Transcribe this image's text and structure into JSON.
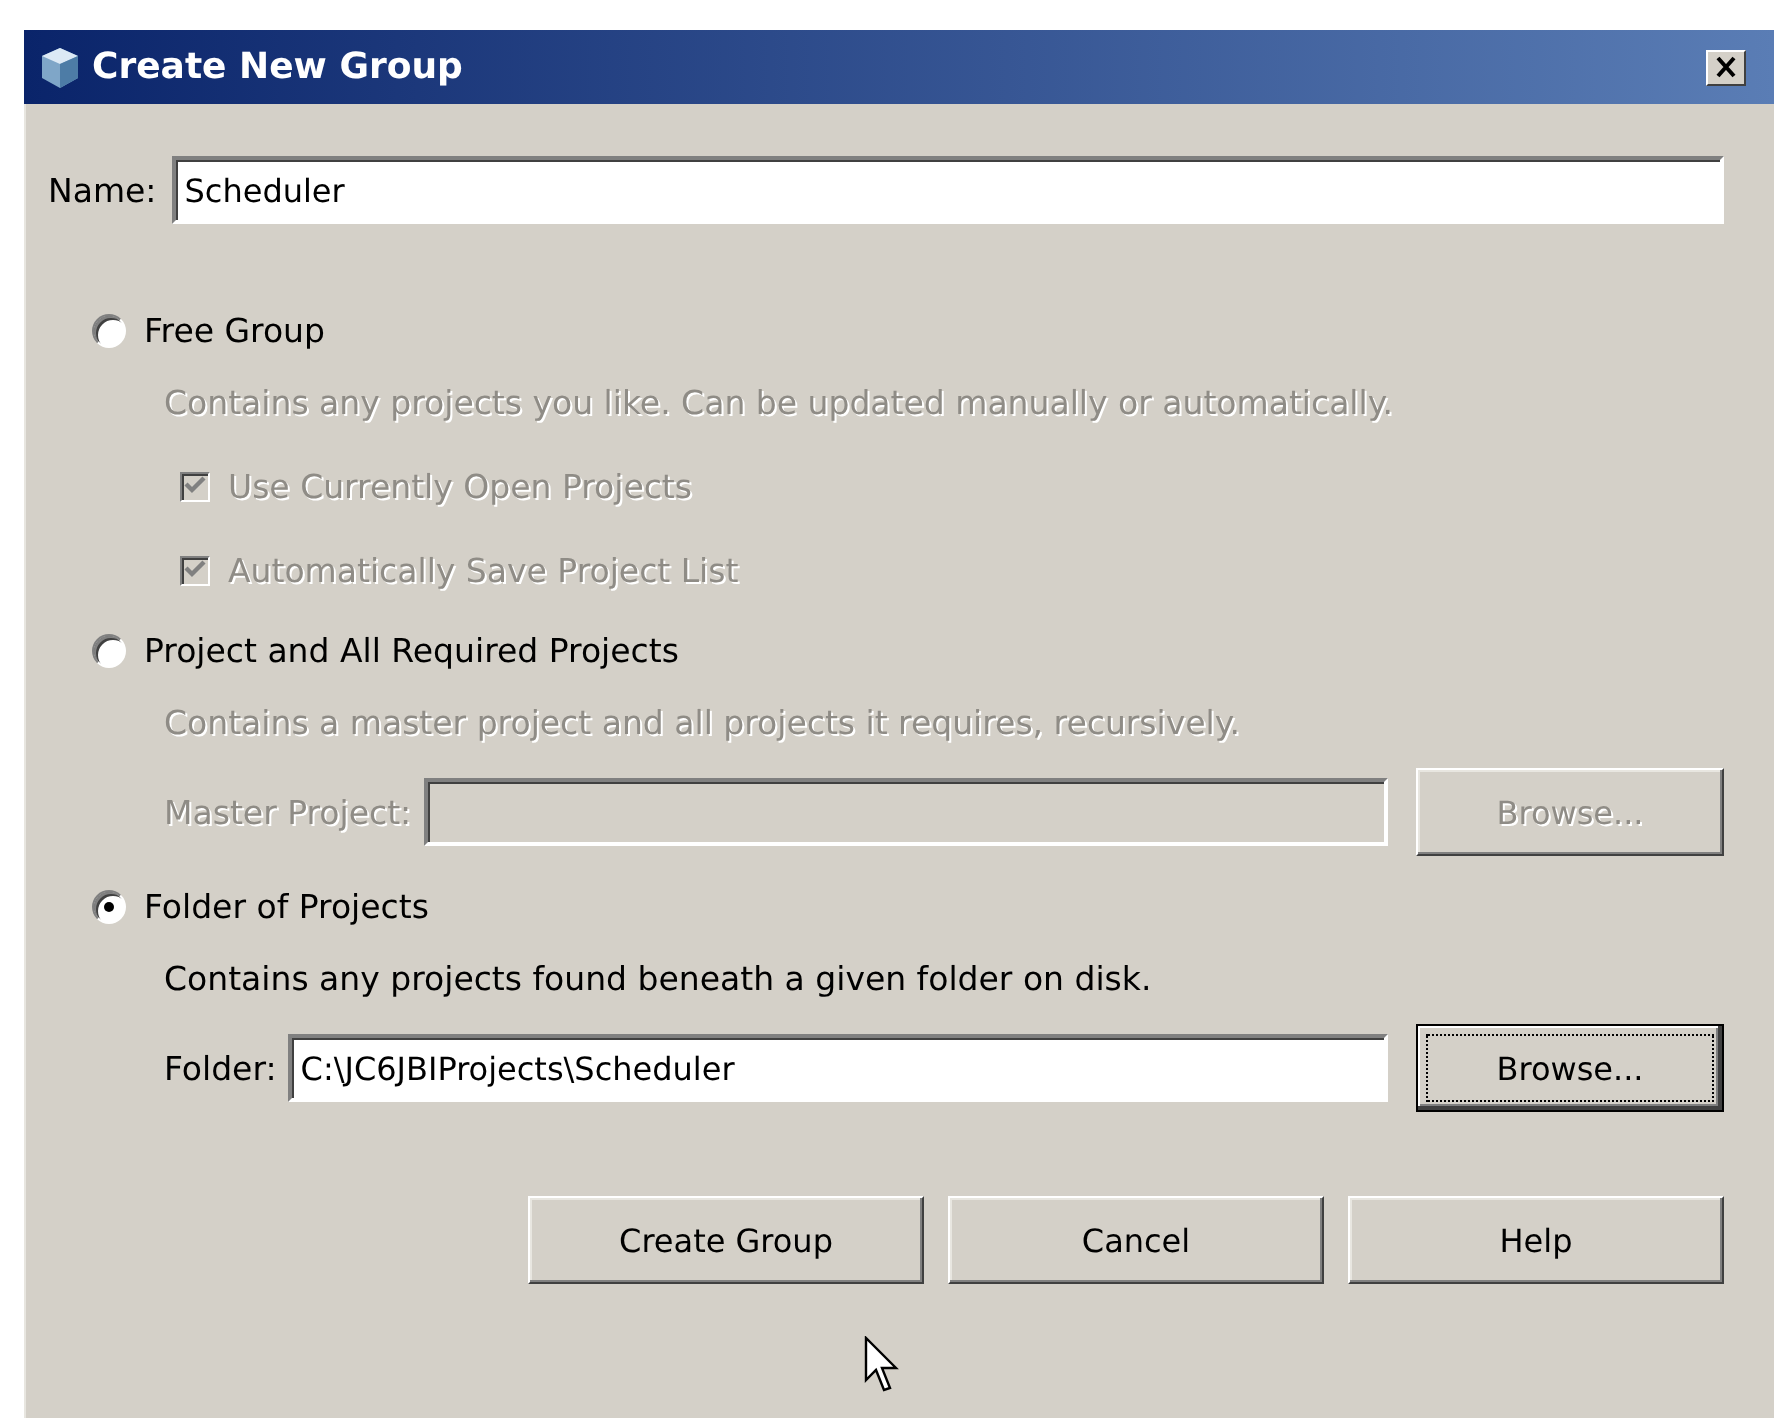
{
  "window": {
    "title": "Create New Group"
  },
  "name_field": {
    "label": "Name:",
    "value": "Scheduler"
  },
  "options": [
    {
      "label": "Free Group",
      "selected": false,
      "description": "Contains any projects you like. Can be updated manually or automatically.",
      "checkboxes": [
        {
          "label": "Use Currently Open Projects",
          "checked": true,
          "disabled": true
        },
        {
          "label": "Automatically Save Project List",
          "checked": true,
          "disabled": true
        }
      ]
    },
    {
      "label": "Project and All Required Projects",
      "selected": false,
      "description": "Contains a master project and all projects it requires, recursively.",
      "field": {
        "label": "Master Project:",
        "disabled": true
      },
      "button": {
        "label": "Browse...",
        "disabled": true,
        "focused": false
      }
    },
    {
      "label": "Folder of Projects",
      "selected": true,
      "description": "Contains any projects found beneath a given folder on disk.",
      "field": {
        "label": "Folder:",
        "value": "C:\\JC6JBIProjects\\Scheduler",
        "disabled": false
      },
      "button": {
        "label": "Browse...",
        "disabled": false,
        "focused": true
      }
    }
  ],
  "buttons": [
    {
      "label": "Create Group"
    },
    {
      "label": "Cancel"
    },
    {
      "label": "Help"
    }
  ]
}
